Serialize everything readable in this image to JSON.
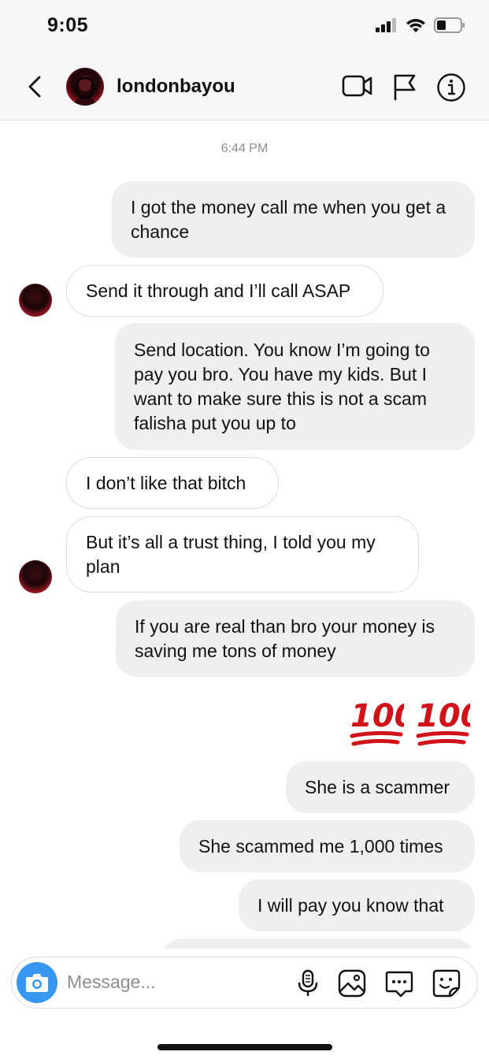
{
  "status": {
    "time": "9:05"
  },
  "header": {
    "username": "londonbayou"
  },
  "chat": {
    "timestamp": "6:44 PM",
    "messages": [
      {
        "from": "me",
        "text": "I got the money call me when you get a chance"
      },
      {
        "from": "them",
        "text": "Send it through and I’ll call ASAP"
      },
      {
        "from": "me",
        "text": "Send location. You know I’m going to pay you bro.  You have my kids.  But I want to make sure this is not a scam falisha put you up to"
      },
      {
        "from": "them",
        "text": "I don’t like that bitch"
      },
      {
        "from": "them",
        "text": "But it’s all a trust thing, I told you my plan"
      },
      {
        "from": "me",
        "text": "If you are real than bro your money is saving me tons of money"
      },
      {
        "from": "me",
        "text": "💯💯",
        "type": "emoji"
      },
      {
        "from": "me",
        "text": "She is a scammer"
      },
      {
        "from": "me",
        "text": "She scammed me 1,000 times"
      },
      {
        "from": "me",
        "text": "I will pay you know that"
      }
    ]
  },
  "composer": {
    "placeholder": "Message..."
  },
  "colors": {
    "accent": "#3897f0",
    "emoji_red": "#d0131b"
  }
}
